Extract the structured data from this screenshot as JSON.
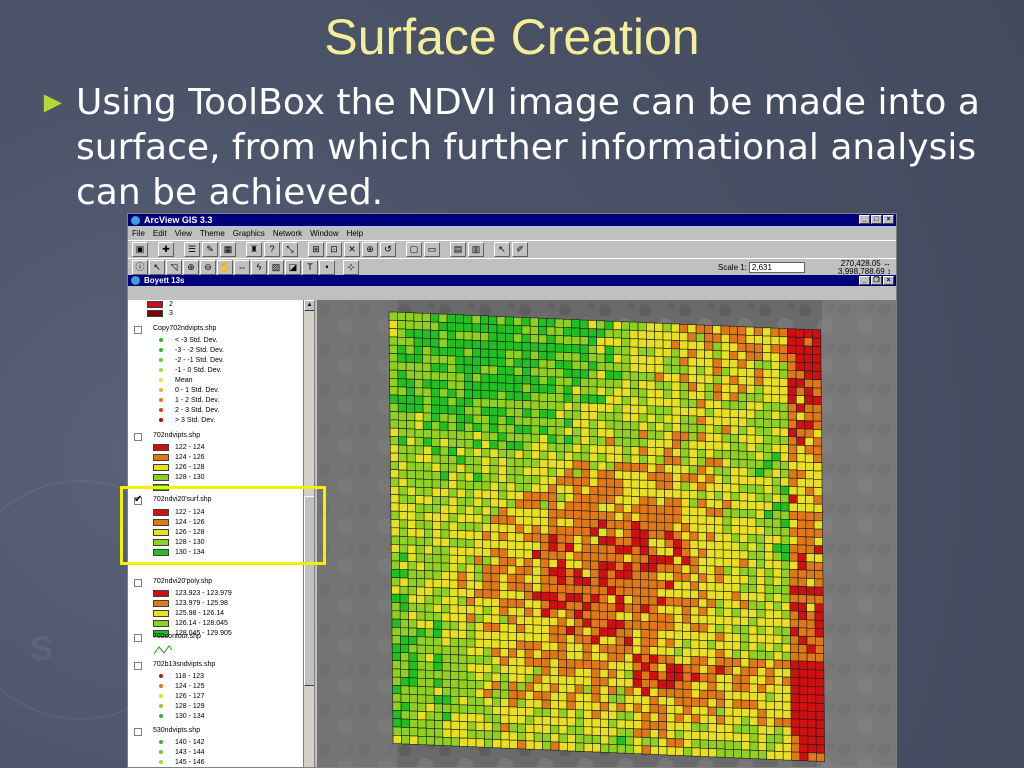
{
  "slide": {
    "title": "Surface Creation",
    "bullet_text": "Using ToolBox the NDVI image can be made into a surface, from which further informational analysis can be achieved."
  },
  "window": {
    "title": "ArcView GIS 3.3",
    "menu": [
      "File",
      "Edit",
      "View",
      "Theme",
      "Graphics",
      "Network",
      "Window",
      "Help"
    ],
    "scale_label": "Scale 1:",
    "scale_value": "2,631",
    "coord_x": "270,428.05",
    "coord_y": "3,998,788.69",
    "view_title": "Boyett 13s"
  },
  "toc": {
    "top_items": [
      {
        "label": "2",
        "color": "#c81010"
      },
      {
        "label": "3",
        "color": "#7a0000"
      }
    ],
    "layer_copy": {
      "name": "Copy702ndvipts.shp",
      "items": [
        {
          "label": "< -3 Std. Dev.",
          "color": "#20c020"
        },
        {
          "label": "-3 - -2 Std. Dev.",
          "color": "#20c020"
        },
        {
          "label": "-2 - -1 Std. Dev.",
          "color": "#60d030"
        },
        {
          "label": "-1 - 0 Std. Dev.",
          "color": "#a0d840"
        },
        {
          "label": "Mean",
          "color": "#e8e040"
        },
        {
          "label": "0 - 1 Std. Dev.",
          "color": "#f0b030"
        },
        {
          "label": "1 - 2 Std. Dev.",
          "color": "#e87020"
        },
        {
          "label": "2 - 3 Std. Dev.",
          "color": "#e04010"
        },
        {
          "label": "> 3 Std. Dev.",
          "color": "#d00000"
        }
      ]
    },
    "layer_ndvipts": {
      "name": "702ndvipts.shp",
      "items": [
        {
          "label": "122 - 124",
          "color": "#d01010"
        },
        {
          "label": "124 - 126",
          "color": "#e07818"
        },
        {
          "label": "126 - 128",
          "color": "#e8e020"
        },
        {
          "label": "128 - 130",
          "color": "#90d020"
        },
        {
          "label": "",
          "color": "#20c020"
        }
      ]
    },
    "layer_surf": {
      "name": "702ndvi20'surf.shp",
      "items": [
        {
          "label": "122 - 124",
          "color": "#d01010"
        },
        {
          "label": "124 - 126",
          "color": "#e07818"
        },
        {
          "label": "126 - 128",
          "color": "#e8e020"
        },
        {
          "label": "128 - 130",
          "color": "#90d020"
        },
        {
          "label": "130 - 134",
          "color": "#20c020"
        }
      ]
    },
    "layer_poly": {
      "name": "702ndvi20'poly.shp",
      "items": [
        {
          "label": "123.923 - 123.979",
          "color": "#d01010"
        },
        {
          "label": "123.979 - 125.98",
          "color": "#e07818"
        },
        {
          "label": "125.98 - 126.14",
          "color": "#e8e020"
        },
        {
          "label": "126.14 - 128.045",
          "color": "#90d020"
        },
        {
          "label": "128.045 - 129.905",
          "color": "#20c020"
        }
      ]
    },
    "layer_contour": {
      "name": "702contour.shp"
    },
    "layer_b13": {
      "name": "702b13sndvipts.shp",
      "items": [
        {
          "label": "118 - 123",
          "color": "#d01010"
        },
        {
          "label": "124 - 125",
          "color": "#e07818"
        },
        {
          "label": "126 - 127",
          "color": "#e8e020"
        },
        {
          "label": "128 - 129",
          "color": "#90d020"
        },
        {
          "label": "130 - 134",
          "color": "#20c020"
        }
      ]
    },
    "layer_530": {
      "name": "530ndvipts.shp",
      "items": [
        {
          "label": "140 - 142",
          "color": "#20c020"
        },
        {
          "label": "143 - 144",
          "color": "#60d030"
        },
        {
          "label": "145 - 146",
          "color": "#a0d840"
        }
      ]
    }
  },
  "colors": {
    "title_yellow": "#f4ee9a",
    "bullet_green": "#b6d834",
    "highlight": "#f4f000",
    "titlebar_blue": "#00007c"
  }
}
